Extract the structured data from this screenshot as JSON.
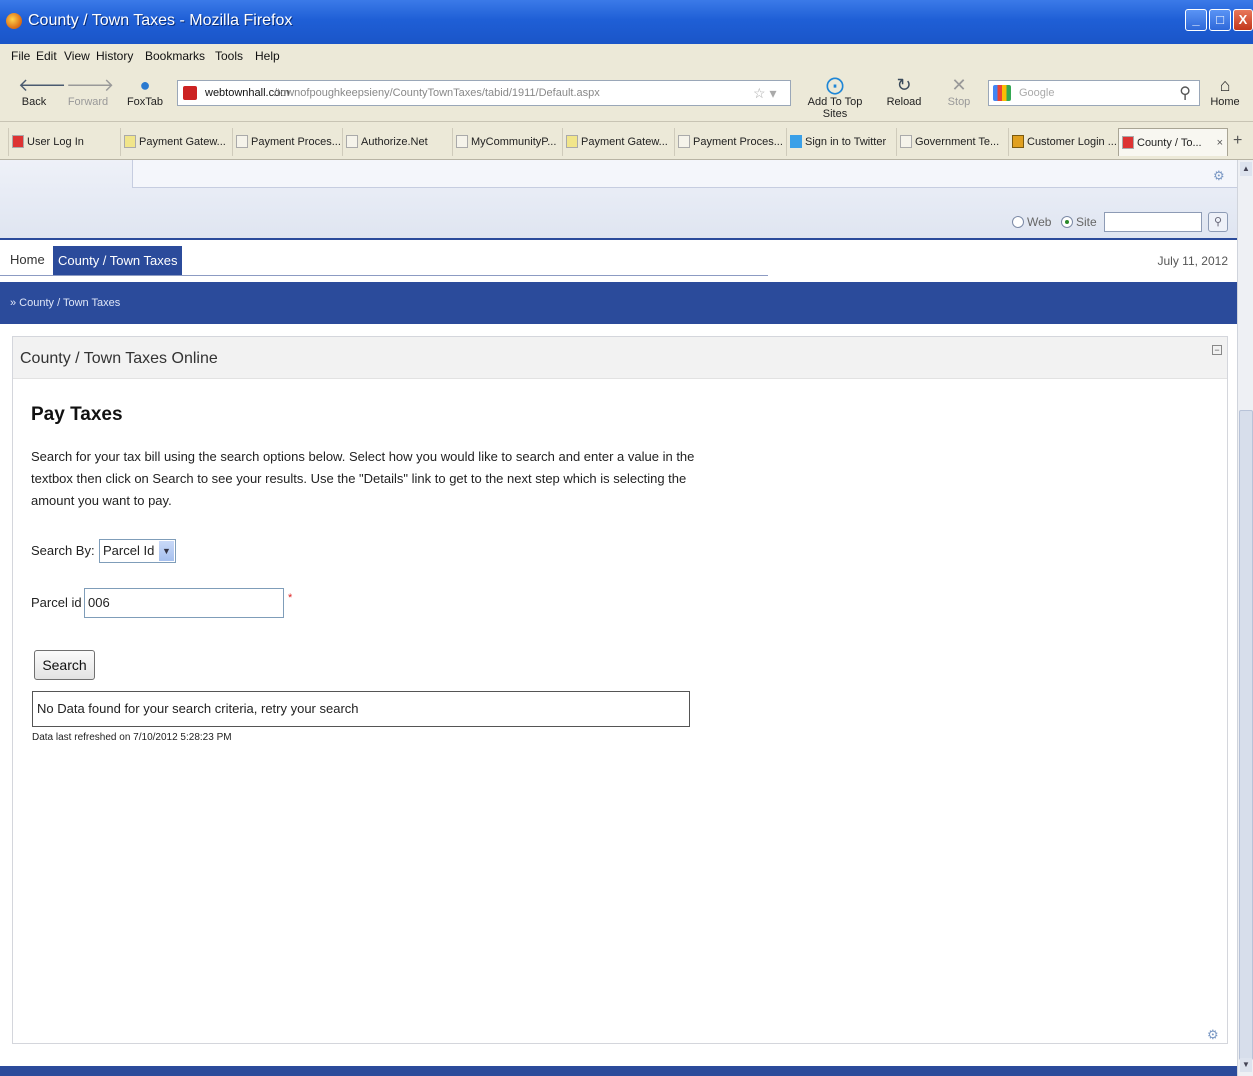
{
  "window": {
    "title": "County / Town Taxes - Mozilla Firefox",
    "min_glyph": "_",
    "max_glyph": "□",
    "close_glyph": "X"
  },
  "menu": [
    "File",
    "Edit",
    "View",
    "History",
    "Bookmarks",
    "Tools",
    "Help"
  ],
  "toolbar": {
    "back": "Back",
    "forward": "Forward",
    "foxtab": "FoxTab",
    "add_to_top_sites": "Add To Top Sites",
    "reload": "Reload",
    "stop": "Stop",
    "home": "Home"
  },
  "address": {
    "host": "webtownhall.com",
    "path": "/townofpoughkeepsieny/CountyTownTaxes/tabid/1911/Default.aspx"
  },
  "search_engine": {
    "placeholder": "Google"
  },
  "tabs": [
    "User Log In",
    "Payment Gatew...",
    "Payment Proces...",
    "Authorize.Net",
    "MyCommunityP...",
    "Payment Gatew...",
    "Payment Proces...",
    "Sign in to Twitter",
    "Government Te...",
    "Customer Login ...",
    "County / To..."
  ],
  "site": {
    "search_web_label": "Web",
    "search_site_label": "Site",
    "search_selected": "Site",
    "nav_home": "Home",
    "nav_active": "County / Town Taxes",
    "date": "July 11, 2012",
    "breadcrumb": "» County / Town Taxes"
  },
  "module": {
    "title": "County / Town Taxes Online",
    "heading": "Pay Taxes",
    "description": "Search for your tax bill using the search options below.  Select how you would like to search and enter a value in the textbox then click on Search to see your results.  Use the \"Details\" link to get to the next step which is selecting the amount you want to pay.",
    "search_by_label": "Search By:",
    "search_by_value": "Parcel Id",
    "parcel_label": "Parcel id",
    "parcel_value": "006",
    "required_mark": "*",
    "search_button": "Search",
    "result_message": "No Data found for your search criteria, retry your search",
    "refreshed": "Data last refreshed on 7/10/2012 5:28:23 PM"
  }
}
